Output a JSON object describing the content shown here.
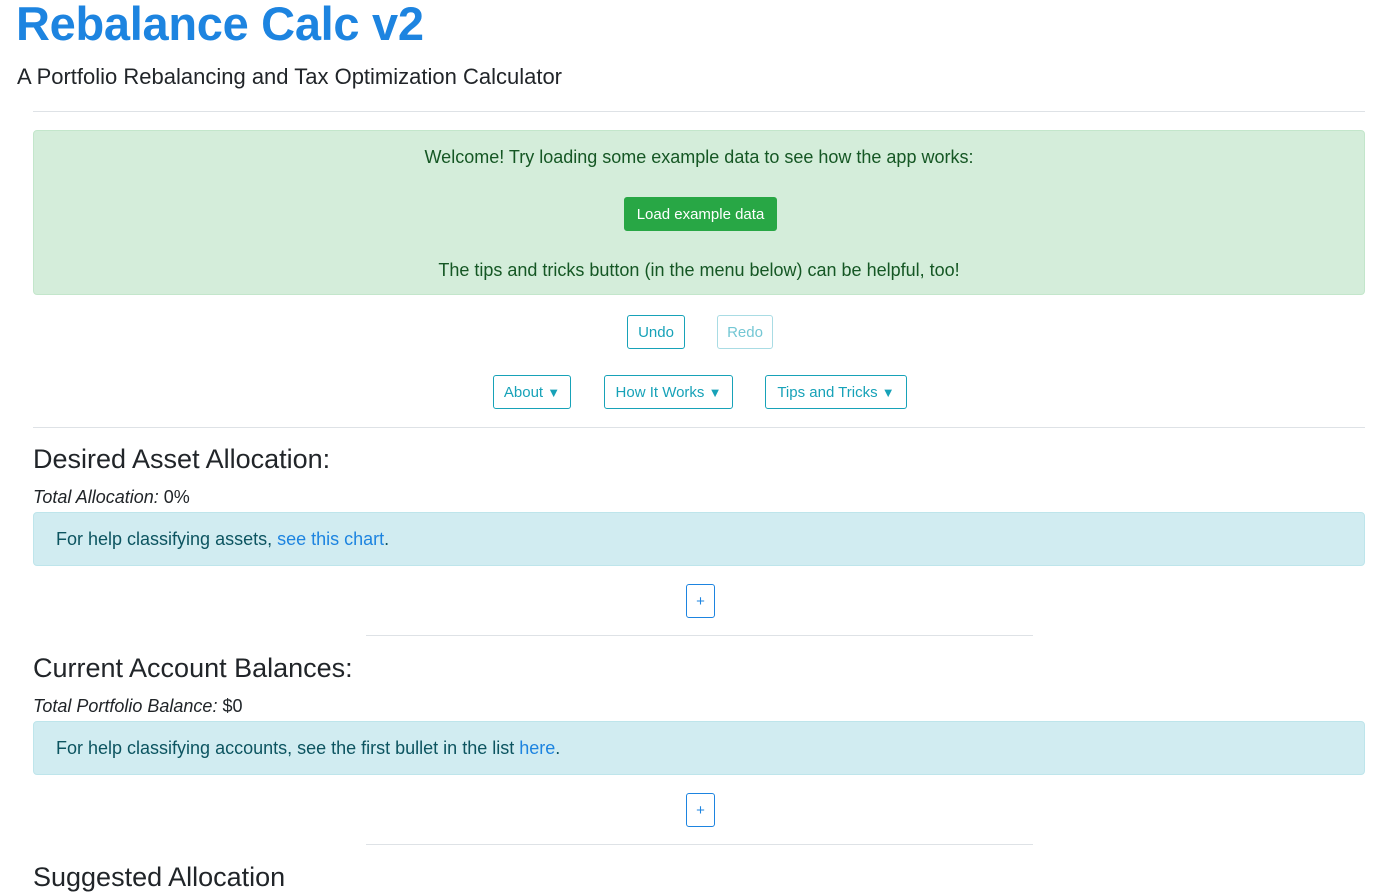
{
  "header": {
    "title": "Rebalance Calc v2",
    "subtitle": "A Portfolio Rebalancing and Tax Optimization Calculator"
  },
  "welcome": {
    "line1": "Welcome! Try loading some example data to see how the app works:",
    "load_button": "Load example data",
    "line2": "The tips and tricks button (in the menu below) can be helpful, too!"
  },
  "history": {
    "undo_label": "Undo",
    "redo_label": "Redo"
  },
  "menu": {
    "about_label": "About",
    "how_it_works_label": "How It Works",
    "tips_label": "Tips and Tricks",
    "dropdown_glyph": "▼"
  },
  "allocation": {
    "heading": "Desired Asset Allocation:",
    "total_label": "Total Allocation:",
    "total_value": "0%",
    "help_prefix": "For help classifying assets, ",
    "help_link": "see this chart",
    "help_suffix": ".",
    "add_label": "+"
  },
  "balances": {
    "heading": "Current Account Balances:",
    "total_label": "Total Portfolio Balance:",
    "total_value": "$0",
    "help_prefix": "For help classifying accounts, see the first bullet in the list ",
    "help_link": "here",
    "help_suffix": ".",
    "add_label": "+"
  },
  "suggested": {
    "heading": "Suggested Allocation"
  },
  "colors": {
    "brand": "#1d84e0",
    "success": "#28a745",
    "info": "#17a2b8",
    "alert_success_bg": "#d4edda",
    "alert_info_bg": "#d1ecf1"
  }
}
